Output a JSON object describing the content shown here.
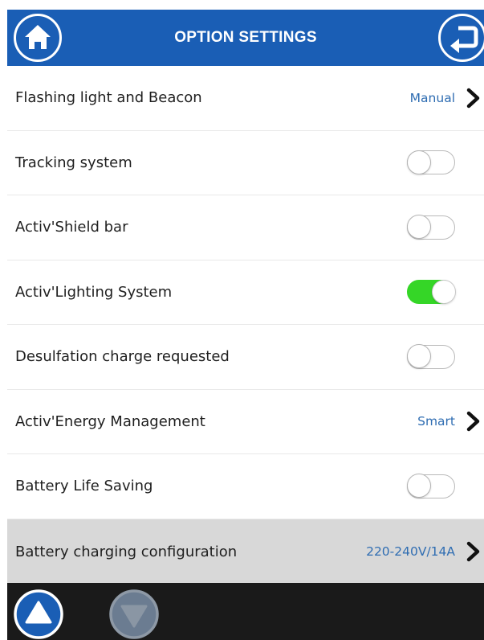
{
  "header": {
    "title": "OPTION SETTINGS",
    "home_icon": "home-icon",
    "back_icon": "return-arrow-icon",
    "color": "#1a5eb5"
  },
  "rows": [
    {
      "label": "Flashing light and Beacon",
      "type": "link",
      "value": "Manual"
    },
    {
      "label": "Tracking system",
      "type": "toggle",
      "on": false
    },
    {
      "label": "Activ'Shield bar",
      "type": "toggle",
      "on": false
    },
    {
      "label": "Activ'Lighting System",
      "type": "toggle",
      "on": true
    },
    {
      "label": "Desulfation charge requested",
      "type": "toggle",
      "on": false
    },
    {
      "label": "Activ'Energy Management",
      "type": "link",
      "value": "Smart"
    },
    {
      "label": "Battery Life Saving",
      "type": "toggle",
      "on": false
    },
    {
      "label": "Battery charging configuration",
      "type": "link",
      "value": "220-240V/14A",
      "highlighted": true
    }
  ],
  "footer": {
    "scroll_up_icon": "triangle-up-icon",
    "scroll_down_icon": "triangle-down-icon",
    "toggle_on_color": "#35d627",
    "value_color": "#2f6db2"
  }
}
